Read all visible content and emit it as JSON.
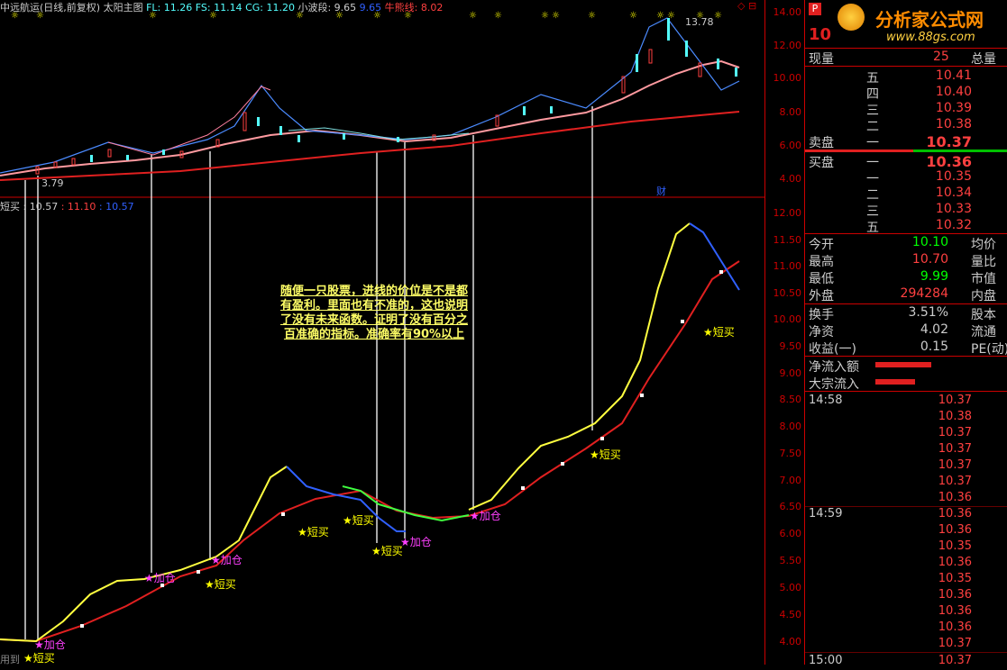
{
  "header": {
    "stock_label": "中远航运(日线,前复权)",
    "indicator_name": "太阳主图",
    "fl": "FL: 11.26",
    "fs": "FS: 11.14",
    "cg": "CG: 11.20",
    "small_wave": "小波段: 9.65",
    "small_wave2": "9.65",
    "bull_bear": "牛熊线: 8.02"
  },
  "sub_header": {
    "label": "短买",
    "v1": ": 10.57",
    "v2": ": 11.10",
    "v3": ": 10.57"
  },
  "price_labels": {
    "high": "13.78",
    "low": "3.79",
    "cai": "财"
  },
  "y_axis_top": [
    "14.00",
    "12.00",
    "10.00",
    "8.00",
    "6.00",
    "4.00"
  ],
  "y_axis_bottom": [
    "12.00",
    "11.50",
    "11.00",
    "10.50",
    "10.00",
    "9.50",
    "9.00",
    "8.50",
    "8.00",
    "7.50",
    "7.00",
    "6.50",
    "6.00",
    "5.50",
    "5.00",
    "4.50",
    "4.00"
  ],
  "note": "随便一只股票，进线的价位是不是都有盈利。里面也有不准的，这也说明了没有未来函数。证明了没有百分之百准确的指标。准确率有90%以上",
  "signals": [
    {
      "text": "★短买",
      "magenta": false
    },
    {
      "text": "★加仓",
      "magenta": true
    },
    {
      "text": "★加仓",
      "magenta": true
    },
    {
      "text": "★短买",
      "magenta": false
    },
    {
      "text": "★加仓",
      "magenta": true
    },
    {
      "text": "★短买",
      "magenta": false
    },
    {
      "text": "★短买",
      "magenta": false
    },
    {
      "text": "★短买",
      "magenta": false
    },
    {
      "text": "★加仓",
      "magenta": true
    },
    {
      "text": "★加仓",
      "magenta": true
    },
    {
      "text": "★短买",
      "magenta": false
    },
    {
      "text": "★短买",
      "magenta": false
    }
  ],
  "bottom_left": "用到",
  "panel": {
    "code_char": "P",
    "code": "10",
    "logo_title": "分析家公式网",
    "logo_url": "www.88gs.com",
    "now_label": "现量",
    "now_val": "25",
    "total_label": "总量",
    "asks": [
      {
        "label": "五",
        "price": "10.41"
      },
      {
        "label": "四",
        "price": "10.40"
      },
      {
        "label": "三",
        "price": "10.39"
      },
      {
        "label": "二",
        "price": "10.38"
      },
      {
        "label": "一",
        "price": "10.37"
      }
    ],
    "sell_label": "卖盘",
    "sell_price": "10.37",
    "buy_label": "买盘",
    "buy_price": "10.36",
    "bids": [
      {
        "label": "一",
        "price": "10.36"
      },
      {
        "label": "二",
        "price": "10.35"
      },
      {
        "label": "三",
        "price": "10.34"
      },
      {
        "label": "四",
        "price": "10.33"
      },
      {
        "label": "五",
        "price": "10.32"
      }
    ],
    "stats": [
      {
        "l": "今开",
        "v": "10.10",
        "c": "#00ff00",
        "r": "均价"
      },
      {
        "l": "最高",
        "v": "10.70",
        "c": "#ff4040",
        "r": "量比"
      },
      {
        "l": "最低",
        "v": "9.99",
        "c": "#00ff00",
        "r": "市值"
      },
      {
        "l": "外盘",
        "v": "294284",
        "c": "#ff4040",
        "r": "内盘"
      }
    ],
    "stats2": [
      {
        "l": "换手",
        "v": "3.51%",
        "r": "股本"
      },
      {
        "l": "净资",
        "v": "4.02",
        "r": "流通"
      },
      {
        "l": "收益(一)",
        "v": "0.15",
        "r": "PE(动)"
      }
    ],
    "flow1": "净流入额",
    "flow2": "大宗流入",
    "ticks": [
      {
        "time": "14:58",
        "price": "10.37"
      },
      {
        "time": "",
        "price": "10.38"
      },
      {
        "time": "",
        "price": "10.37"
      },
      {
        "time": "",
        "price": "10.37"
      },
      {
        "time": "",
        "price": "10.37"
      },
      {
        "time": "",
        "price": "10.37"
      },
      {
        "time": "",
        "price": "10.36"
      },
      {
        "time": "14:59",
        "price": "10.36"
      },
      {
        "time": "",
        "price": "10.36"
      },
      {
        "time": "",
        "price": "10.35"
      },
      {
        "time": "",
        "price": "10.36"
      },
      {
        "time": "",
        "price": "10.35"
      },
      {
        "time": "",
        "price": "10.36"
      },
      {
        "time": "",
        "price": "10.36"
      },
      {
        "time": "",
        "price": "10.36"
      },
      {
        "time": "",
        "price": "10.37"
      },
      {
        "time": "15:00",
        "price": "10.37"
      }
    ]
  }
}
